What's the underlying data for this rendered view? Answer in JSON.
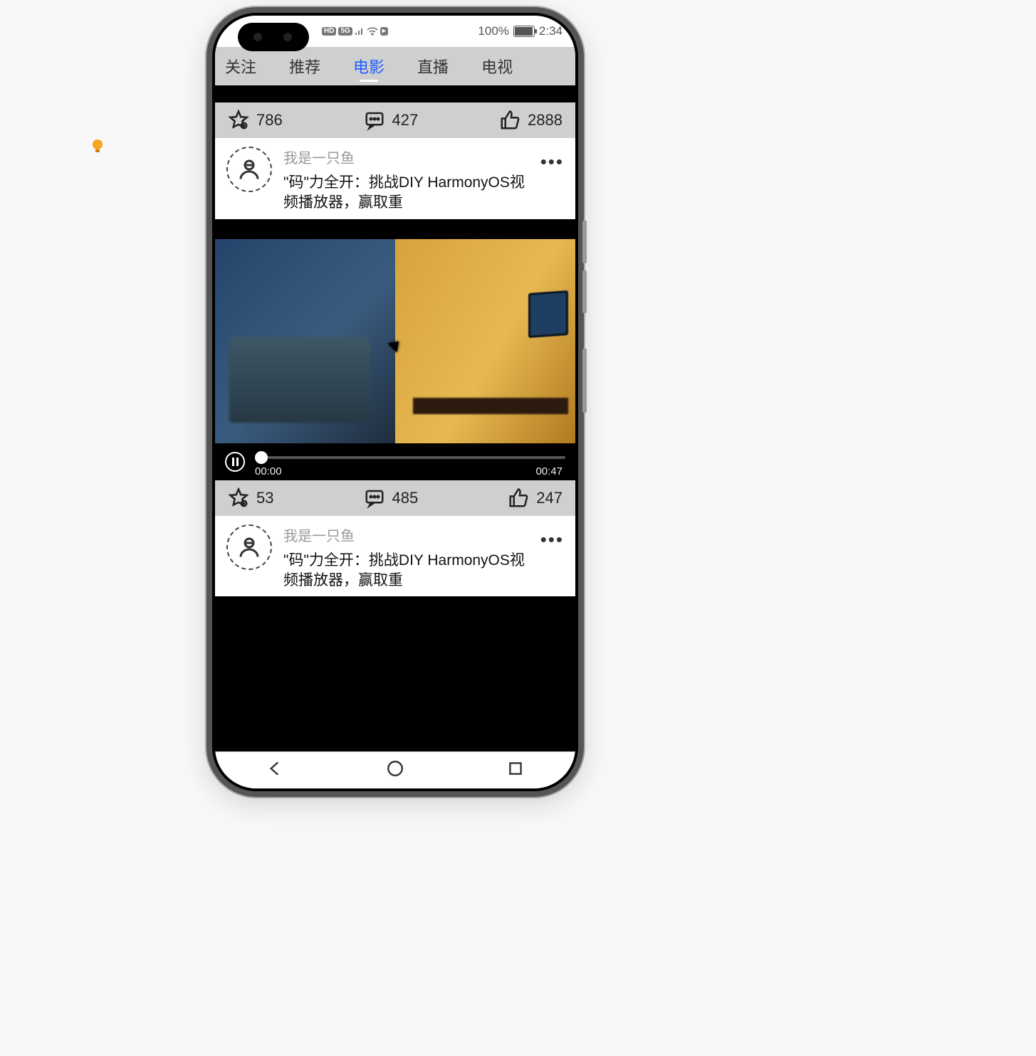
{
  "status": {
    "battery_text": "100%",
    "time": "2:34",
    "icons": [
      "HD",
      "5G",
      "signal",
      "wifi",
      "rec"
    ]
  },
  "tabs": [
    {
      "label": "关注",
      "active": false
    },
    {
      "label": "推荐",
      "active": false
    },
    {
      "label": "电影",
      "active": true
    },
    {
      "label": "直播",
      "active": false
    },
    {
      "label": "电视",
      "active": false
    }
  ],
  "posts": [
    {
      "stats": {
        "fav": "786",
        "comment": "427",
        "like": "2888"
      },
      "author": "我是一只鱼",
      "title": "\"码\"力全开：挑战DIY HarmonyOS视频播放器，赢取重"
    },
    {
      "video": {
        "current": "00:00",
        "duration": "00:47"
      },
      "stats": {
        "fav": "53",
        "comment": "485",
        "like": "247"
      },
      "author": "我是一只鱼",
      "title": "\"码\"力全开：挑战DIY HarmonyOS视频播放器，赢取重"
    }
  ]
}
